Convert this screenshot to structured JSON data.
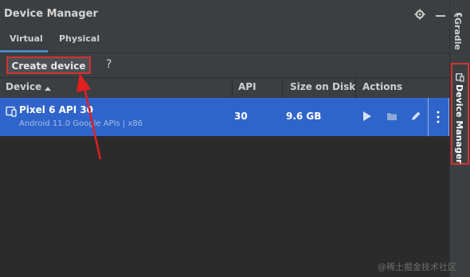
{
  "window": {
    "title": "Device Manager"
  },
  "tabs": [
    {
      "label": "Virtual",
      "active": true
    },
    {
      "label": "Physical",
      "active": false
    }
  ],
  "toolbar": {
    "create_label": "Create device",
    "help_label": "?"
  },
  "table": {
    "columns": [
      "Device",
      "API",
      "Size on Disk",
      "Actions"
    ],
    "rows": [
      {
        "name": "Pixel 6 API 30",
        "description": "Android 11.0 Google APIs | x86",
        "api": "30",
        "size": "9.6 GB",
        "actions": [
          "play-icon",
          "folder-icon",
          "edit-icon",
          "more-icon"
        ]
      }
    ]
  },
  "sidebar": {
    "items": [
      {
        "label": "Gradle"
      },
      {
        "label": "Device Manager",
        "active": true
      }
    ]
  },
  "watermark": "@稀土掘金技术社区",
  "colors": {
    "selection": "#2f65ca",
    "highlight": "#d33232",
    "panel": "#3c3f41",
    "background": "#2b2b2b"
  }
}
